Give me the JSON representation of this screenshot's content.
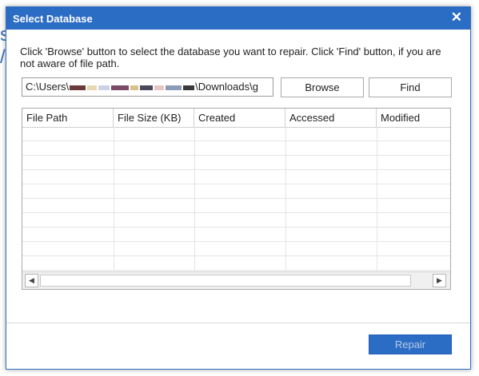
{
  "colors": {
    "title_bar": "#2b6cc4",
    "repair_button": "#2b6cc4",
    "repair_text_disabled": "#b7cde9",
    "border": "#a9a9a9"
  },
  "dialog": {
    "title": "Select Database",
    "close_glyph": "✕",
    "instruction": "Click 'Browse' button to select the database you want to repair. Click 'Find' button, if you are not aware of file path.",
    "path_prefix": "C:\\Users\\",
    "path_suffix": "\\Downloads\\g",
    "browse_label": "Browse",
    "find_label": "Find",
    "repair_label": "Repair",
    "repair_enabled": false
  },
  "table": {
    "columns": [
      "File Path",
      "File Size (KB)",
      "Created",
      "Accessed",
      "Modified"
    ],
    "rows": []
  },
  "scrollbar": {
    "left_glyph": "◀",
    "right_glyph": "▶"
  },
  "icons": [
    "close-icon",
    "scroll-left-icon",
    "scroll-right-icon"
  ]
}
